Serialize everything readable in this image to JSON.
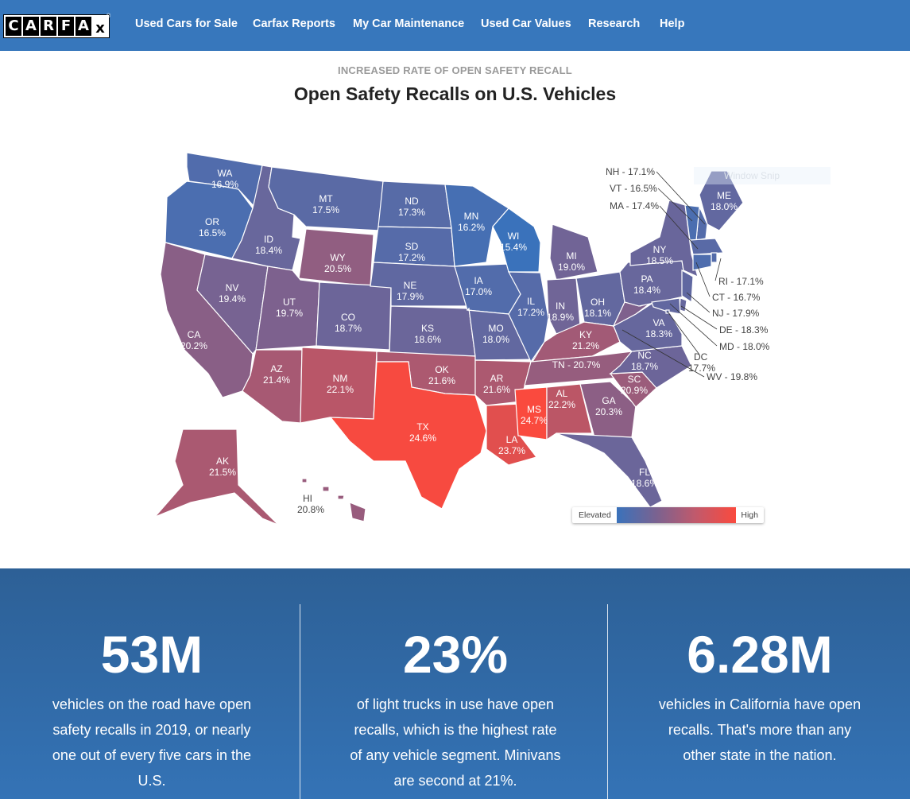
{
  "nav": {
    "logo_letters": [
      "C",
      "A",
      "R",
      "F",
      "A",
      "x"
    ],
    "items": [
      "Used Cars for Sale",
      "Carfax Reports",
      "My Car Maintenance",
      "Used Car Values",
      "Research",
      "Help"
    ]
  },
  "header": {
    "kicker": "INCREASED RATE OF OPEN SAFETY RECALL",
    "title": "Open Safety Recalls on U.S. Vehicles"
  },
  "overlay": {
    "window_snip": "Window Snip"
  },
  "map": {
    "metric": "Percent of vehicles with open safety recalls",
    "color_scale": {
      "low_label": "Elevated",
      "high_label": "High",
      "low_color": "#3a72bb",
      "mid_color": "#7a6290",
      "high_color": "#fa4a3e",
      "min": 15.4,
      "max": 24.7
    },
    "states": [
      {
        "code": "WA",
        "value": 16.9
      },
      {
        "code": "OR",
        "value": 16.5
      },
      {
        "code": "CA",
        "value": 20.2
      },
      {
        "code": "NV",
        "value": 19.4
      },
      {
        "code": "ID",
        "value": 18.4
      },
      {
        "code": "MT",
        "value": 17.5
      },
      {
        "code": "WY",
        "value": 20.5
      },
      {
        "code": "UT",
        "value": 19.7
      },
      {
        "code": "AZ",
        "value": 21.4
      },
      {
        "code": "CO",
        "value": 18.7
      },
      {
        "code": "NM",
        "value": 22.1
      },
      {
        "code": "ND",
        "value": 17.3
      },
      {
        "code": "SD",
        "value": 17.2
      },
      {
        "code": "NE",
        "value": 17.9
      },
      {
        "code": "KS",
        "value": 18.6
      },
      {
        "code": "OK",
        "value": 21.6
      },
      {
        "code": "TX",
        "value": 24.6
      },
      {
        "code": "MN",
        "value": 16.2
      },
      {
        "code": "IA",
        "value": 17.0
      },
      {
        "code": "MO",
        "value": 18.0
      },
      {
        "code": "AR",
        "value": 21.6
      },
      {
        "code": "LA",
        "value": 23.7
      },
      {
        "code": "WI",
        "value": 15.4
      },
      {
        "code": "IL",
        "value": 17.2
      },
      {
        "code": "MI",
        "value": 19.0
      },
      {
        "code": "IN",
        "value": 18.9
      },
      {
        "code": "OH",
        "value": 18.1
      },
      {
        "code": "KY",
        "value": 21.2
      },
      {
        "code": "TN",
        "value": 20.7
      },
      {
        "code": "MS",
        "value": 24.7
      },
      {
        "code": "AL",
        "value": 22.2
      },
      {
        "code": "GA",
        "value": 20.3
      },
      {
        "code": "FL",
        "value": 18.6
      },
      {
        "code": "SC",
        "value": 20.9
      },
      {
        "code": "NC",
        "value": 18.7
      },
      {
        "code": "VA",
        "value": 18.3
      },
      {
        "code": "WV",
        "value": 19.8
      },
      {
        "code": "PA",
        "value": 18.4
      },
      {
        "code": "NY",
        "value": 18.5
      },
      {
        "code": "ME",
        "value": 18.0
      },
      {
        "code": "NH",
        "value": 17.1
      },
      {
        "code": "VT",
        "value": 16.5
      },
      {
        "code": "MA",
        "value": 17.4
      },
      {
        "code": "RI",
        "value": 17.1
      },
      {
        "code": "CT",
        "value": 16.7
      },
      {
        "code": "NJ",
        "value": 17.9
      },
      {
        "code": "DE",
        "value": 18.3
      },
      {
        "code": "MD",
        "value": 18.0
      },
      {
        "code": "DC",
        "value": 17.7
      },
      {
        "code": "AK",
        "value": 21.5
      },
      {
        "code": "HI",
        "value": 20.8
      }
    ]
  },
  "stats": [
    {
      "value": "53M",
      "text": "vehicles on the road have open safety recalls in 2019, or nearly one out of every five cars in the U.S."
    },
    {
      "value": "23%",
      "text": "of light trucks in use have open recalls, which is the highest rate of any vehicle segment. Minivans are second at 21%."
    },
    {
      "value": "6.28M",
      "text": "vehicles in California have open recalls. That's more than any other state in the nation."
    }
  ]
}
